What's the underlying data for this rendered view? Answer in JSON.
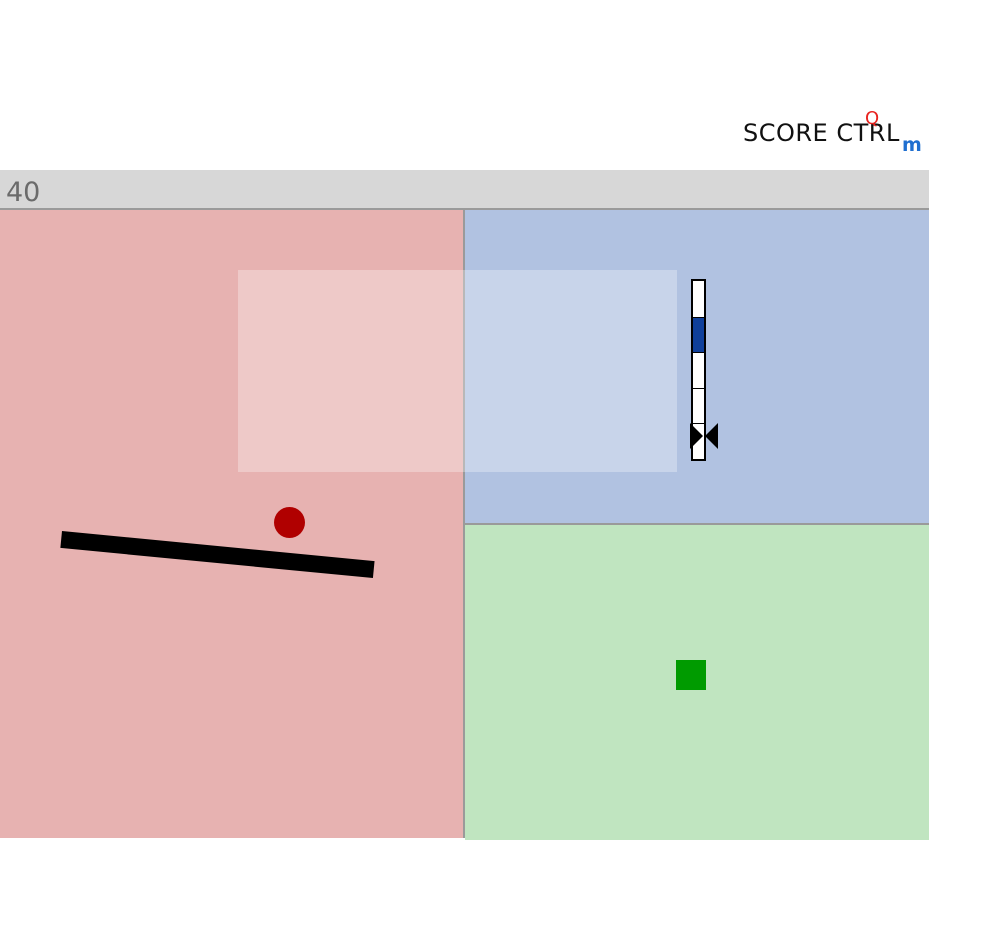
{
  "header": {
    "score_label": "SCORE CTRL",
    "marker_q": "Q",
    "marker_m": "m"
  },
  "top_bar": {
    "score_value": "40"
  },
  "panels": {
    "left_color": "#e7b2b1",
    "top_right_color": "#b1c2e1",
    "bottom_right_color": "#c0e5c0"
  },
  "objects": {
    "paddle_color": "#000000",
    "ball_color": "#b00000",
    "target_color": "#009b00",
    "gauge_fill_color": "#0f3f9a",
    "gauge_segments": 5,
    "gauge_highlighted_segment": 1,
    "gauge_pointer_level": 0.13
  }
}
